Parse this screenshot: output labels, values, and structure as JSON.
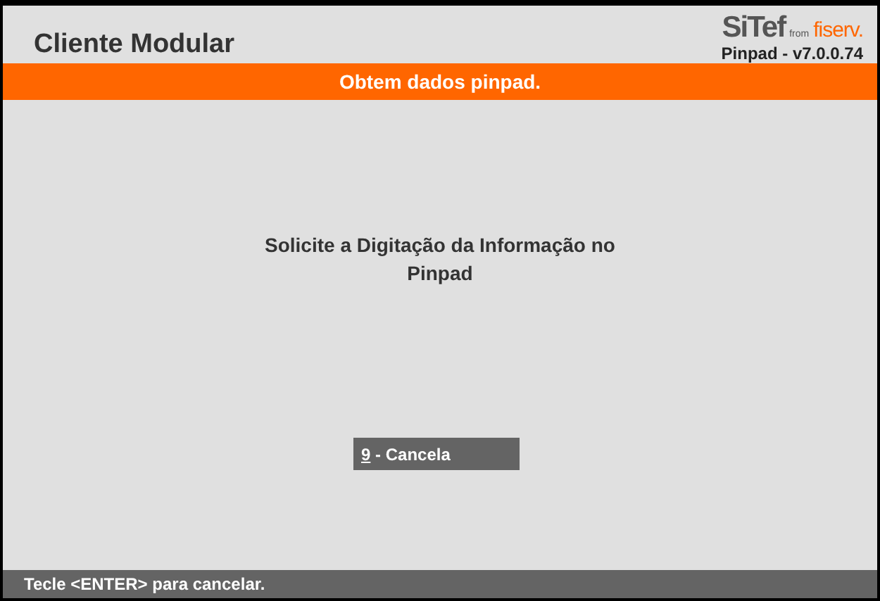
{
  "header": {
    "title": "Cliente Modular",
    "logo": {
      "brand": "SiTef",
      "from": "from",
      "partner": "fiserv."
    },
    "version": "Pinpad - v7.0.0.74"
  },
  "banner": "Obtem dados pinpad.",
  "message": "Solicite a Digitação da Informação no Pinpad",
  "buttons": [
    {
      "key": "9",
      "label": "- Cancela"
    }
  ],
  "status_bar": "Tecle <ENTER> para cancelar."
}
